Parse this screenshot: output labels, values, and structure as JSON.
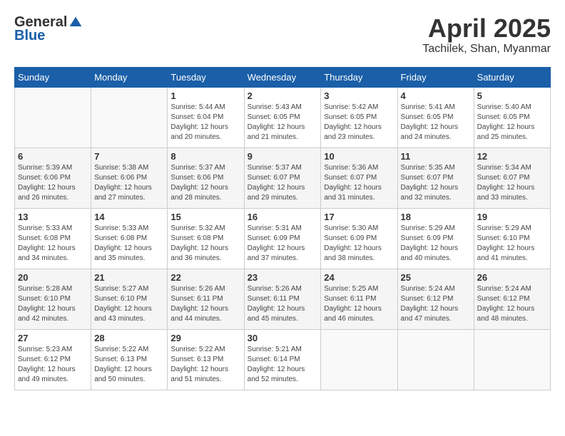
{
  "logo": {
    "general": "General",
    "blue": "Blue"
  },
  "title": {
    "month": "April 2025",
    "location": "Tachilek, Shan, Myanmar"
  },
  "weekdays": [
    "Sunday",
    "Monday",
    "Tuesday",
    "Wednesday",
    "Thursday",
    "Friday",
    "Saturday"
  ],
  "weeks": [
    [
      {
        "day": "",
        "info": ""
      },
      {
        "day": "",
        "info": ""
      },
      {
        "day": "1",
        "info": "Sunrise: 5:44 AM\nSunset: 6:04 PM\nDaylight: 12 hours and 20 minutes."
      },
      {
        "day": "2",
        "info": "Sunrise: 5:43 AM\nSunset: 6:05 PM\nDaylight: 12 hours and 21 minutes."
      },
      {
        "day": "3",
        "info": "Sunrise: 5:42 AM\nSunset: 6:05 PM\nDaylight: 12 hours and 23 minutes."
      },
      {
        "day": "4",
        "info": "Sunrise: 5:41 AM\nSunset: 6:05 PM\nDaylight: 12 hours and 24 minutes."
      },
      {
        "day": "5",
        "info": "Sunrise: 5:40 AM\nSunset: 6:05 PM\nDaylight: 12 hours and 25 minutes."
      }
    ],
    [
      {
        "day": "6",
        "info": "Sunrise: 5:39 AM\nSunset: 6:06 PM\nDaylight: 12 hours and 26 minutes."
      },
      {
        "day": "7",
        "info": "Sunrise: 5:38 AM\nSunset: 6:06 PM\nDaylight: 12 hours and 27 minutes."
      },
      {
        "day": "8",
        "info": "Sunrise: 5:37 AM\nSunset: 6:06 PM\nDaylight: 12 hours and 28 minutes."
      },
      {
        "day": "9",
        "info": "Sunrise: 5:37 AM\nSunset: 6:07 PM\nDaylight: 12 hours and 29 minutes."
      },
      {
        "day": "10",
        "info": "Sunrise: 5:36 AM\nSunset: 6:07 PM\nDaylight: 12 hours and 31 minutes."
      },
      {
        "day": "11",
        "info": "Sunrise: 5:35 AM\nSunset: 6:07 PM\nDaylight: 12 hours and 32 minutes."
      },
      {
        "day": "12",
        "info": "Sunrise: 5:34 AM\nSunset: 6:07 PM\nDaylight: 12 hours and 33 minutes."
      }
    ],
    [
      {
        "day": "13",
        "info": "Sunrise: 5:33 AM\nSunset: 6:08 PM\nDaylight: 12 hours and 34 minutes."
      },
      {
        "day": "14",
        "info": "Sunrise: 5:33 AM\nSunset: 6:08 PM\nDaylight: 12 hours and 35 minutes."
      },
      {
        "day": "15",
        "info": "Sunrise: 5:32 AM\nSunset: 6:08 PM\nDaylight: 12 hours and 36 minutes."
      },
      {
        "day": "16",
        "info": "Sunrise: 5:31 AM\nSunset: 6:09 PM\nDaylight: 12 hours and 37 minutes."
      },
      {
        "day": "17",
        "info": "Sunrise: 5:30 AM\nSunset: 6:09 PM\nDaylight: 12 hours and 38 minutes."
      },
      {
        "day": "18",
        "info": "Sunrise: 5:29 AM\nSunset: 6:09 PM\nDaylight: 12 hours and 40 minutes."
      },
      {
        "day": "19",
        "info": "Sunrise: 5:29 AM\nSunset: 6:10 PM\nDaylight: 12 hours and 41 minutes."
      }
    ],
    [
      {
        "day": "20",
        "info": "Sunrise: 5:28 AM\nSunset: 6:10 PM\nDaylight: 12 hours and 42 minutes."
      },
      {
        "day": "21",
        "info": "Sunrise: 5:27 AM\nSunset: 6:10 PM\nDaylight: 12 hours and 43 minutes."
      },
      {
        "day": "22",
        "info": "Sunrise: 5:26 AM\nSunset: 6:11 PM\nDaylight: 12 hours and 44 minutes."
      },
      {
        "day": "23",
        "info": "Sunrise: 5:26 AM\nSunset: 6:11 PM\nDaylight: 12 hours and 45 minutes."
      },
      {
        "day": "24",
        "info": "Sunrise: 5:25 AM\nSunset: 6:11 PM\nDaylight: 12 hours and 46 minutes."
      },
      {
        "day": "25",
        "info": "Sunrise: 5:24 AM\nSunset: 6:12 PM\nDaylight: 12 hours and 47 minutes."
      },
      {
        "day": "26",
        "info": "Sunrise: 5:24 AM\nSunset: 6:12 PM\nDaylight: 12 hours and 48 minutes."
      }
    ],
    [
      {
        "day": "27",
        "info": "Sunrise: 5:23 AM\nSunset: 6:12 PM\nDaylight: 12 hours and 49 minutes."
      },
      {
        "day": "28",
        "info": "Sunrise: 5:22 AM\nSunset: 6:13 PM\nDaylight: 12 hours and 50 minutes."
      },
      {
        "day": "29",
        "info": "Sunrise: 5:22 AM\nSunset: 6:13 PM\nDaylight: 12 hours and 51 minutes."
      },
      {
        "day": "30",
        "info": "Sunrise: 5:21 AM\nSunset: 6:14 PM\nDaylight: 12 hours and 52 minutes."
      },
      {
        "day": "",
        "info": ""
      },
      {
        "day": "",
        "info": ""
      },
      {
        "day": "",
        "info": ""
      }
    ]
  ]
}
